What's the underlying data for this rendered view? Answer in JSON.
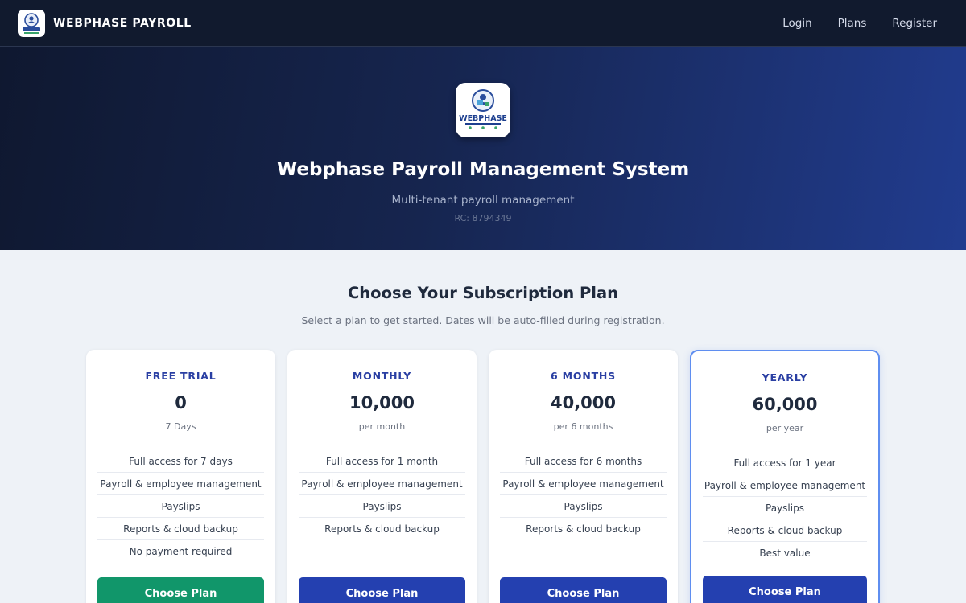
{
  "navbar": {
    "brand": "WEBPHASE PAYROLL",
    "links": [
      "Login",
      "Plans",
      "Register"
    ]
  },
  "hero": {
    "logo_text": "WEBPHASE",
    "title": "Webphase Payroll Management System",
    "subtitle": "Multi-tenant payroll management",
    "rc": "RC: 8794349"
  },
  "plans": {
    "title": "Choose Your Subscription Plan",
    "subtitle": "Select a plan to get started. Dates will be auto-filled during registration.",
    "cards": [
      {
        "name": "FREE TRIAL",
        "price": "0",
        "period": "7 Days",
        "features": [
          "Full access for 7 days",
          "Payroll & employee management",
          "Payslips",
          "Reports & cloud backup",
          "No payment required"
        ],
        "button": "Choose Plan"
      },
      {
        "name": "MONTHLY",
        "price": "10,000",
        "period": "per month",
        "features": [
          "Full access for 1 month",
          "Payroll & employee management",
          "Payslips",
          "Reports & cloud backup"
        ],
        "button": "Choose Plan"
      },
      {
        "name": "6 MONTHS",
        "price": "40,000",
        "period": "per 6 months",
        "features": [
          "Full access for 6 months",
          "Payroll & employee management",
          "Payslips",
          "Reports & cloud backup"
        ],
        "button": "Choose Plan"
      },
      {
        "name": "YEARLY",
        "price": "60,000",
        "period": "per year",
        "features": [
          "Full access for 1 year",
          "Payroll & employee management",
          "Payslips",
          "Reports & cloud backup",
          "Best value"
        ],
        "button": "Choose Plan"
      }
    ]
  },
  "colors": {
    "navbar_bg": "#111a2e",
    "hero_start": "#0f1830",
    "hero_end": "#213c8f",
    "plan_name": "#2a3fa3",
    "primary_button": "#2440b0",
    "trial_button": "#11966a",
    "featured_border": "#5f8ef0"
  }
}
